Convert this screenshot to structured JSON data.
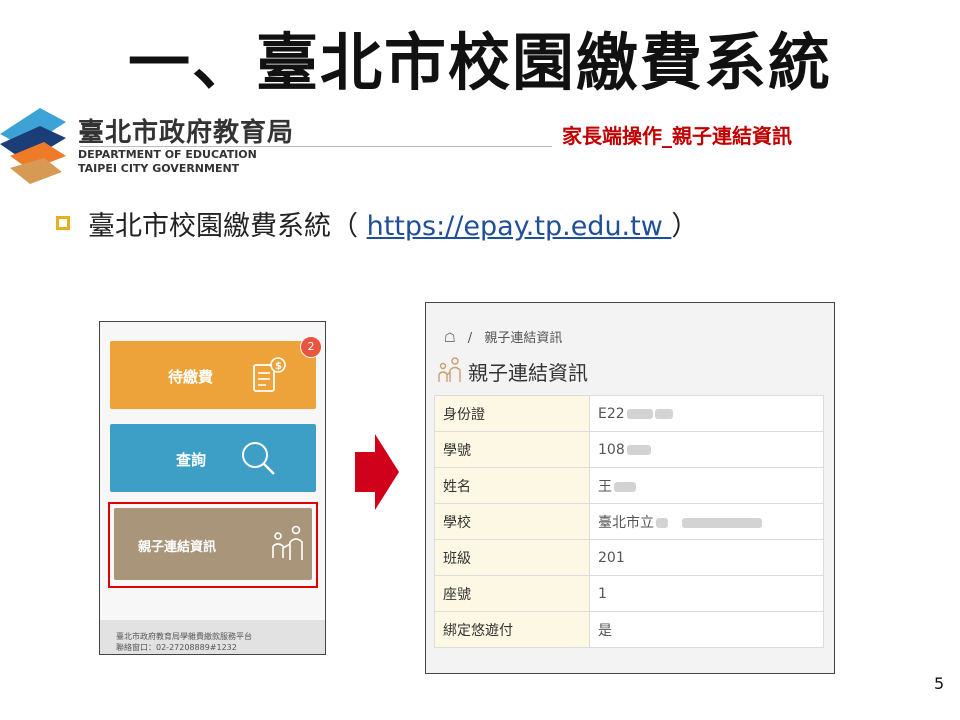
{
  "slide": {
    "title": "一、臺北市校園繳費系統",
    "org_name_cn": "臺北市政府教育局",
    "org_name_en_1": "DEPARTMENT OF  EDUCATION",
    "org_name_en_2": "TAIPEI CITY GOVERNMENT",
    "subtitle": "家長端操作_親子連結資訊",
    "bullet_prefix": "臺北市校園繳費系統（ ",
    "bullet_link": "https://epay.tp.edu.tw ",
    "bullet_suffix": " ）",
    "page_number": "5"
  },
  "phone": {
    "tiles": [
      {
        "label": "待繳費",
        "icon": "bill-icon",
        "color": "#eda33a"
      },
      {
        "label": "查詢",
        "icon": "search-icon",
        "color": "#3d9fc6"
      },
      {
        "label": "親子連結資訊",
        "icon": "parent-child-icon",
        "color": "#a8957a"
      }
    ],
    "badge_count": "2",
    "footer_line1": "臺北市政府教育局學雜費繳款服務平台",
    "footer_line2": "聯絡窗口：02-27208889#1232"
  },
  "detail": {
    "breadcrumb_sep": "/",
    "breadcrumb_current": "親子連結資訊",
    "title": "親子連結資訊",
    "rows": [
      {
        "key": "身份證",
        "value": "E22"
      },
      {
        "key": "學號",
        "value": "108"
      },
      {
        "key": "姓名",
        "value": "王"
      },
      {
        "key": "學校",
        "value": "臺北市立"
      },
      {
        "key": "班級",
        "value": "201"
      },
      {
        "key": "座號",
        "value": "1"
      },
      {
        "key": "綁定悠遊付",
        "value": "是"
      }
    ]
  },
  "colors": {
    "accent_red": "#c00000",
    "highlight_outline": "#e00000",
    "arrow": "#d0021b",
    "bullet": "#e6b020",
    "link": "#1f4e9a"
  }
}
